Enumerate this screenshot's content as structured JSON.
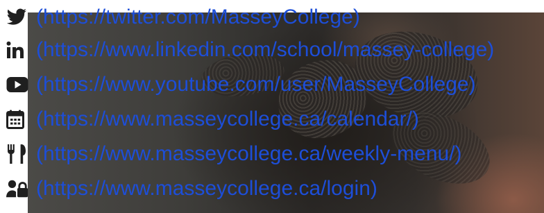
{
  "social_links": [
    {
      "icon": "twitter-icon",
      "url_text": "(https://twitter.com/MasseyCollege)"
    },
    {
      "icon": "linkedin-icon",
      "url_text": "(https://www.linkedin.com/school/massey-college)"
    },
    {
      "icon": "youtube-icon",
      "url_text": "(https://www.youtube.com/user/MasseyCollege)"
    },
    {
      "icon": "calendar-icon",
      "url_text": "(https://www.masseycollege.ca/calendar/)"
    },
    {
      "icon": "utensils-icon",
      "url_text": "(https://www.masseycollege.ca/weekly-menu/)"
    },
    {
      "icon": "user-lock-icon",
      "url_text": "(https://www.masseycollege.ca/login)"
    }
  ],
  "colors": {
    "link": "#1d4ed8",
    "icon": "#1f1f1f"
  }
}
